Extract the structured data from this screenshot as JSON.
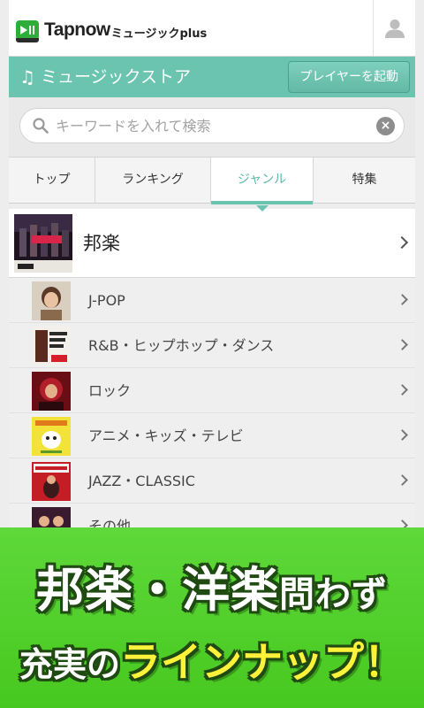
{
  "app": {
    "logo_text": "Tapnow",
    "logo_suffix": "ミュージックplus",
    "logo_sub": "Tapnow",
    "user_icon": "user-icon"
  },
  "store": {
    "title": "ミュージックストア",
    "note_icon": "♫",
    "launch_button": "プレイヤーを起動"
  },
  "search": {
    "placeholder": "キーワードを入れて検索",
    "value": ""
  },
  "tabs": [
    {
      "label": "トップ",
      "active": false
    },
    {
      "label": "ランキング",
      "active": false
    },
    {
      "label": "ジャンル",
      "active": true
    },
    {
      "label": "特集",
      "active": false
    }
  ],
  "genre": {
    "title": "邦楽",
    "subgenres": [
      {
        "label": "J-POP"
      },
      {
        "label": "R&B・ヒップホップ・ダンス"
      },
      {
        "label": "ロック"
      },
      {
        "label": "アニメ・キッズ・テレビ"
      },
      {
        "label": "JAZZ・CLASSIC"
      },
      {
        "label": "その他"
      }
    ]
  },
  "promo": {
    "line1_a": "邦楽・洋楽",
    "line1_b": "問わず",
    "line2_a": "充実の",
    "line2_b": "ラインナップ！"
  },
  "colors": {
    "accent": "#6bc4b0",
    "promo_green": "#4fd02a",
    "promo_yellow": "#fff23a"
  }
}
